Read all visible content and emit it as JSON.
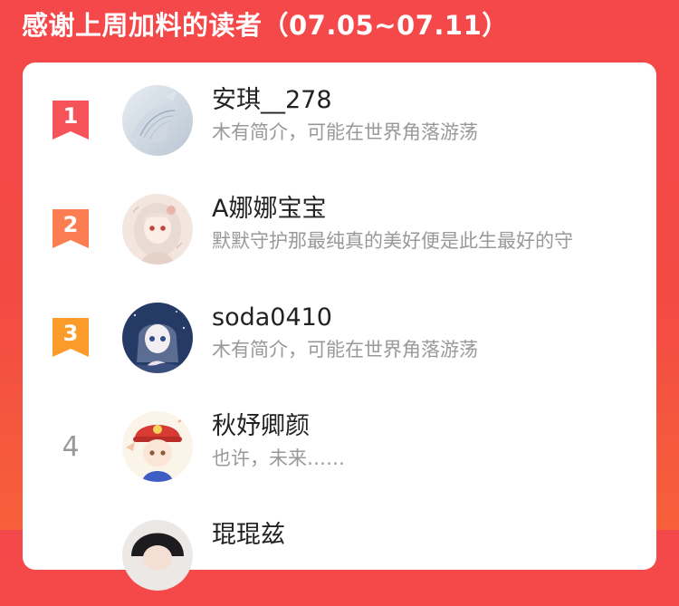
{
  "header": {
    "title": "感谢上周加料的读者（07.05~07.11）"
  },
  "readers": [
    {
      "rank": "1",
      "username": "安琪__278",
      "bio": "木有简介，可能在世界角落游荡",
      "badge_color": "#f5525a"
    },
    {
      "rank": "2",
      "username": "A娜娜宝宝",
      "bio": "默默守护那最纯真的美好便是此生最好的守",
      "badge_color": "#fb7d52"
    },
    {
      "rank": "3",
      "username": "soda0410",
      "bio": "木有简介，可能在世界角落游荡",
      "badge_color": "#fb9c2a"
    },
    {
      "rank": "4",
      "username": "秋妤卿颜",
      "bio": "也许，未来……"
    },
    {
      "username": "琨琨兹"
    }
  ],
  "colors": {
    "background": "#f5484a",
    "card": "#ffffff",
    "username_text": "#222222",
    "bio_text": "#999999",
    "rank_plain_text": "#999999"
  },
  "icons": [
    "ribbon-badge-icon"
  ]
}
